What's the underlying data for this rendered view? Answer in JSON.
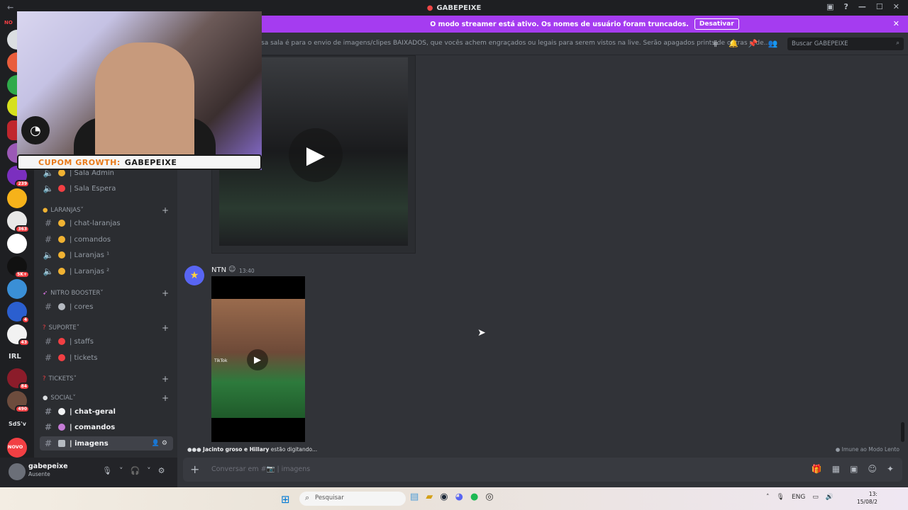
{
  "window": {
    "title": "GABEPEIXE"
  },
  "notice": {
    "text": "O modo streamer está ativo. Os nomes de usuário foram truncados.",
    "button": "Desativar"
  },
  "topic": "sa sala é para o envio de imagens/clipes BAIXADOS, que vocês achem engraçados ou legais para serem vistos na live. Serão apagados prints de outras rede...",
  "search": {
    "placeholder": "Buscar GABEPEIXE"
  },
  "guild_badges": [
    "239",
    "363",
    "5K+",
    "4",
    "43",
    "84",
    "490"
  ],
  "guild_labels": {
    "novo_top": "NO",
    "irl": "IRL",
    "sds": "SdS'v",
    "novo": "NOVO"
  },
  "sidebar": {
    "voice": [
      {
        "label": "| Sala Admin"
      },
      {
        "label": "| Sala Espera"
      }
    ],
    "categories": [
      {
        "name": "LARANJAS"
      },
      {
        "name": "NITRO BOOSTER"
      },
      {
        "name": "SUPORTE"
      },
      {
        "name": "TICKETS"
      },
      {
        "name": "SOCIAL"
      }
    ],
    "laranjas": [
      {
        "label": "| chat-laranjas"
      },
      {
        "label": "| comandos"
      },
      {
        "label": "| Laranjas ¹"
      },
      {
        "label": "| Laranjas ²"
      }
    ],
    "nitro": [
      {
        "label": "| cores"
      }
    ],
    "suporte": [
      {
        "label": "| staffs"
      },
      {
        "label": "| tickets"
      }
    ],
    "social": [
      {
        "label": "| chat-geral"
      },
      {
        "label": "| comandos"
      },
      {
        "label": "| imagens"
      }
    ]
  },
  "user": {
    "name": "gabepeixe",
    "status": "Ausente"
  },
  "message": {
    "author": "NTN",
    "time": "13:40"
  },
  "video": {
    "tiktok_label": "TikTok"
  },
  "typing": {
    "users": "Jacinto groso e Hillary",
    "suffix": "estão digitando..."
  },
  "slowmode": "Imune ao Modo Lento",
  "composer": {
    "placeholder": "Conversar em #📷 | imagens"
  },
  "stream_overlay": {
    "coupon_label": "CUPOM GROWTH:",
    "coupon_code": "GABEPEIXE"
  },
  "taskbar": {
    "search_label": "Pesquisar",
    "lang": "ENG",
    "time": "13:",
    "date": "15/08/2"
  },
  "colors": {
    "accent": "#a53cf0",
    "bg": "#313338",
    "sidebar": "#2b2d31"
  }
}
